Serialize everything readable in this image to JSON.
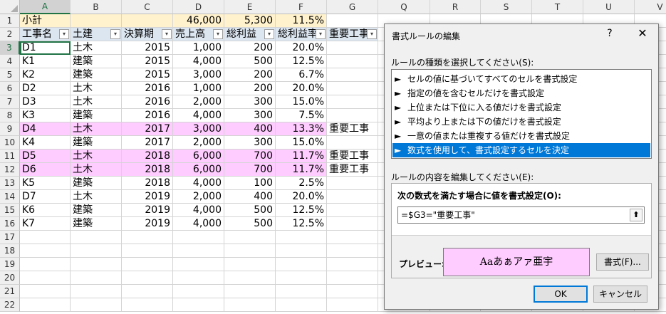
{
  "columns": [
    "A",
    "B",
    "C",
    "D",
    "E",
    "F",
    "G",
    "",
    "Q",
    "R",
    "S",
    "T",
    "U",
    "V"
  ],
  "rows": [
    "1",
    "2",
    "3",
    "4",
    "5",
    "6",
    "7",
    "8",
    "9",
    "10",
    "11",
    "12",
    "13",
    "14",
    "15",
    "16",
    "17",
    "18",
    "19",
    "20",
    "21",
    "22"
  ],
  "subtotal": {
    "label": "小計",
    "d": "46,000",
    "e": "5,300",
    "f": "11.5%"
  },
  "headers": [
    "工事名",
    "土建",
    "決算期",
    "売上高",
    "総利益",
    "総利益率",
    "重要工事"
  ],
  "data_rows": [
    {
      "a": "D1",
      "b": "土木",
      "c": "2015",
      "d": "1,000",
      "e": "200",
      "f": "20.0%",
      "g": ""
    },
    {
      "a": "K1",
      "b": "建築",
      "c": "2015",
      "d": "4,000",
      "e": "500",
      "f": "12.5%",
      "g": ""
    },
    {
      "a": "K2",
      "b": "建築",
      "c": "2015",
      "d": "3,000",
      "e": "200",
      "f": "6.7%",
      "g": ""
    },
    {
      "a": "D2",
      "b": "土木",
      "c": "2016",
      "d": "1,000",
      "e": "200",
      "f": "20.0%",
      "g": ""
    },
    {
      "a": "D3",
      "b": "土木",
      "c": "2016",
      "d": "2,000",
      "e": "300",
      "f": "15.0%",
      "g": ""
    },
    {
      "a": "K3",
      "b": "建築",
      "c": "2016",
      "d": "4,000",
      "e": "300",
      "f": "7.5%",
      "g": ""
    },
    {
      "a": "D4",
      "b": "土木",
      "c": "2017",
      "d": "3,000",
      "e": "400",
      "f": "13.3%",
      "g": "重要工事"
    },
    {
      "a": "K4",
      "b": "建築",
      "c": "2017",
      "d": "2,000",
      "e": "300",
      "f": "15.0%",
      "g": ""
    },
    {
      "a": "D5",
      "b": "土木",
      "c": "2018",
      "d": "6,000",
      "e": "700",
      "f": "11.7%",
      "g": "重要工事"
    },
    {
      "a": "D6",
      "b": "土木",
      "c": "2018",
      "d": "6,000",
      "e": "700",
      "f": "11.7%",
      "g": "重要工事"
    },
    {
      "a": "K5",
      "b": "建築",
      "c": "2018",
      "d": "4,000",
      "e": "100",
      "f": "2.5%",
      "g": ""
    },
    {
      "a": "D7",
      "b": "土木",
      "c": "2019",
      "d": "2,000",
      "e": "400",
      "f": "20.0%",
      "g": ""
    },
    {
      "a": "K6",
      "b": "建築",
      "c": "2019",
      "d": "4,000",
      "e": "500",
      "f": "12.5%",
      "g": ""
    },
    {
      "a": "K7",
      "b": "建築",
      "c": "2019",
      "d": "4,000",
      "e": "500",
      "f": "12.5%",
      "g": ""
    }
  ],
  "dialog": {
    "title": "書式ルールの編集",
    "help": "?",
    "close": "✕",
    "type_label": "ルールの種類を選択してください(S):",
    "rules": [
      "セルの値に基づいてすべてのセルを書式設定",
      "指定の値を含むセルだけを書式設定",
      "上位または下位に入る値だけを書式設定",
      "平均より上または下の値だけを書式設定",
      "一意の値または重複する値だけを書式設定",
      "数式を使用して、書式設定するセルを決定"
    ],
    "rule_arrow": "►",
    "edit_label": "ルールの内容を編集してください(E):",
    "formula_label": "次の数式を満たす場合に値を書式設定(O):",
    "formula_value": "=$G3=\"重要工事\"",
    "formula_button": "⬆",
    "preview_label": "プレビュー:",
    "preview_text": "Aaあぁアァ亜宇",
    "format_button": "書式(F)...",
    "ok": "OK",
    "cancel": "キャンセル"
  },
  "colors": {
    "pink": "#ffccff",
    "subtotal": "#fff2cc",
    "header": "#dce6f1",
    "accent": "#0078d7",
    "excel_green": "#217346"
  },
  "icons": {
    "filter": "▾",
    "rule_arrow": "►"
  }
}
